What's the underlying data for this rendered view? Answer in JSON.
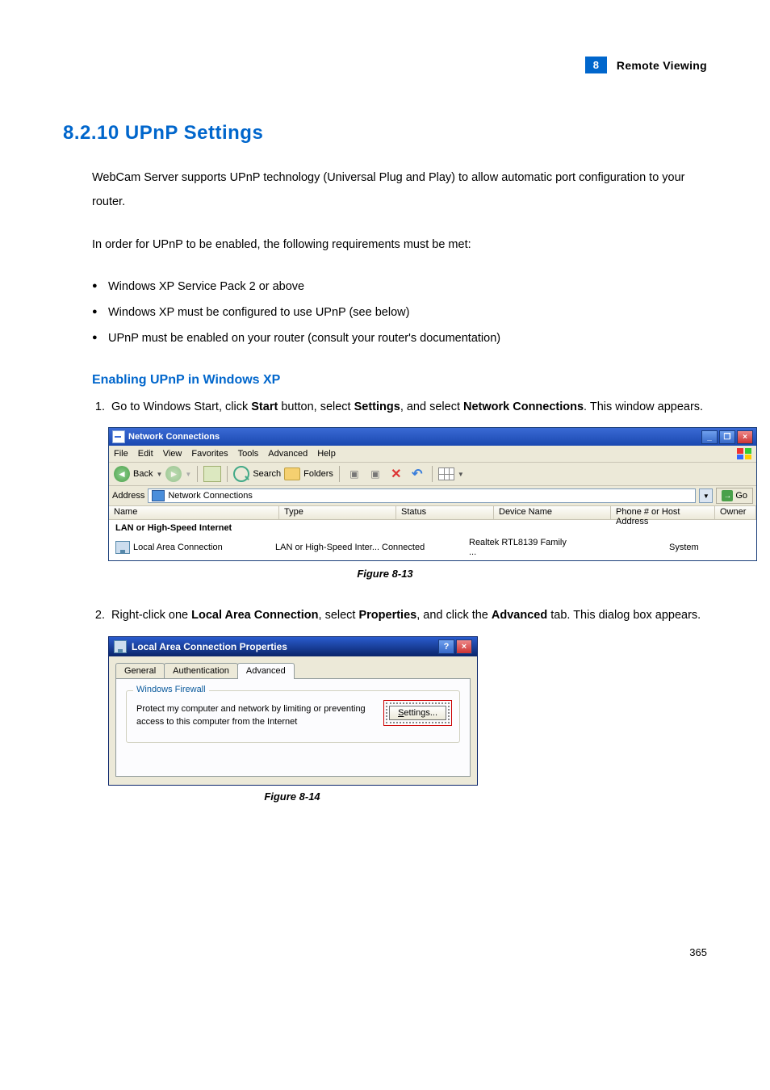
{
  "header": {
    "badge": "8",
    "title": "Remote Viewing"
  },
  "section": {
    "heading": "8.2.10   UPnP Settings",
    "para1": "WebCam Server supports UPnP technology (Universal Plug and Play) to allow automatic port configuration to your router.",
    "para2": "In order for UPnP to be enabled, the following requirements must be met:",
    "bullets": [
      "Windows XP Service Pack 2 or above",
      "Windows XP must be configured to use UPnP (see below)",
      "UPnP must be enabled on your router (consult your router's documentation)"
    ]
  },
  "subsection": {
    "heading": "Enabling UPnP in Windows XP",
    "step1_pre": "Go to Windows Start, click ",
    "step1_b1": "Start",
    "step1_mid1": " button, select ",
    "step1_b2": "Settings",
    "step1_mid2": ", and select ",
    "step1_b3": "Network Connections",
    "step1_post": ". This window appears.",
    "step2_pre": "Right-click one ",
    "step2_b1": "Local Area Connection",
    "step2_mid1": ", select ",
    "step2_b2": "Properties",
    "step2_mid2": ", and click the ",
    "step2_b3": "Advanced",
    "step2_post": " tab. This dialog box appears."
  },
  "fig13": {
    "caption": "Figure 8-13",
    "title": "Network Connections",
    "menu": [
      "File",
      "Edit",
      "View",
      "Favorites",
      "Tools",
      "Advanced",
      "Help"
    ],
    "back": "Back",
    "search": "Search",
    "folders": "Folders",
    "addr_label": "Address",
    "addr_value": "Network Connections",
    "go": "Go",
    "cols": {
      "name": "Name",
      "type": "Type",
      "status": "Status",
      "dev": "Device Name",
      "phone": "Phone # or Host Address",
      "owner": "Owner"
    },
    "group": "LAN or High-Speed Internet",
    "row": {
      "name": "Local Area Connection",
      "type": "LAN or High-Speed Inter...",
      "status": "Connected",
      "dev": "Realtek RTL8139 Family ...",
      "phone": "",
      "owner": "System"
    }
  },
  "fig14": {
    "caption": "Figure 8-14",
    "title": "Local Area Connection Properties",
    "tabs": [
      "General",
      "Authentication",
      "Advanced"
    ],
    "group_legend": "Windows Firewall",
    "group_text": "Protect my computer and network by limiting or preventing access to this computer from the Internet",
    "settings_btn_pre": "S",
    "settings_btn_rest": "ettings..."
  },
  "page_number": "365"
}
